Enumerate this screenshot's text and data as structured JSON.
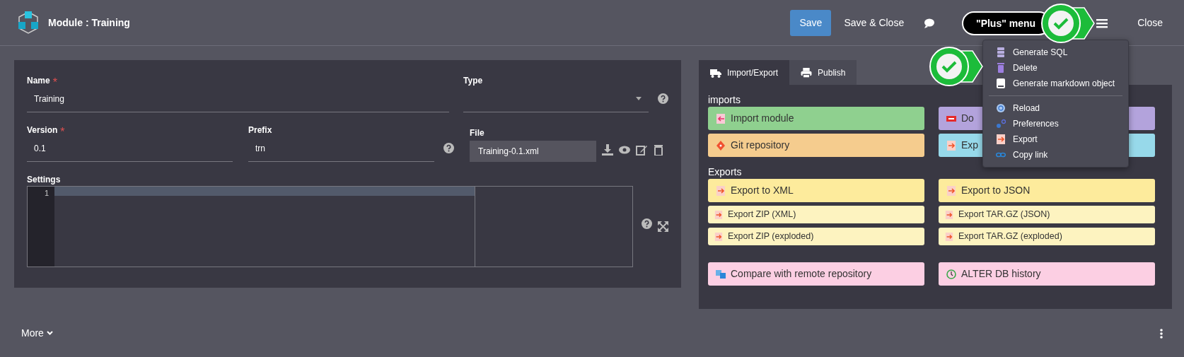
{
  "header": {
    "title": "Module : Training",
    "actions": [
      {
        "kind": "primary",
        "label": "Save"
      },
      {
        "kind": "link",
        "label": "Save & Close"
      },
      {
        "kind": "comment"
      },
      {
        "kind": "menu"
      },
      {
        "kind": "link",
        "label": "Close"
      }
    ]
  },
  "tooltip": {
    "text": "\"Plus\" menu"
  },
  "menu": {
    "groups": [
      [
        {
          "kind": "sql",
          "label": "Generate SQL"
        },
        {
          "kind": "delete",
          "label": "Delete"
        },
        {
          "kind": "markdown",
          "label": "Generate markdown object"
        }
      ],
      [
        {
          "kind": "reload",
          "label": "Reload"
        },
        {
          "kind": "preferences",
          "label": "Preferences"
        },
        {
          "kind": "export",
          "label": "Export"
        },
        {
          "kind": "link",
          "label": "Copy link"
        }
      ]
    ]
  },
  "form": {
    "name": {
      "label": "Name",
      "required_mark": "*",
      "value": "Training"
    },
    "type": {
      "label": "Type"
    },
    "version": {
      "label": "Version",
      "required_mark": "*",
      "value": "0.1"
    },
    "prefix": {
      "label": "Prefix",
      "value": "trn"
    },
    "file": {
      "label": "File",
      "value": "Training-0.1.xml"
    },
    "settings": {
      "label": "Settings",
      "line_numbers": [
        "1"
      ]
    }
  },
  "tabs": [
    {
      "kind": "truck",
      "label": "Import/Export",
      "selected": true
    },
    {
      "kind": "print",
      "label": "Publish",
      "selected": false
    }
  ],
  "sections": [
    {
      "title": "imports",
      "rows": [
        [
          {
            "kind": "import",
            "label": "Import module",
            "color": "#8fd08f",
            "compact": false
          },
          {
            "kind": "pdf",
            "label": "Do",
            "color": "#b3a3dc",
            "compact": false
          }
        ],
        [
          {
            "kind": "git",
            "label": "Git repository",
            "color": "#f5cc8e",
            "compact": false
          },
          {
            "kind": "export",
            "label": "Exp",
            "color": "#97d9ea",
            "compact": false
          }
        ]
      ]
    },
    {
      "title": "Exports",
      "rows": [
        [
          {
            "kind": "export",
            "label": "Export to XML",
            "color": "#fdeb9c",
            "compact": false
          },
          {
            "kind": "export",
            "label": "Export to JSON",
            "color": "#fdeb9c",
            "compact": false
          }
        ],
        [
          {
            "kind": "export",
            "label": "Export ZIP (XML)",
            "color": "#fdf3c0",
            "compact": true
          },
          {
            "kind": "export",
            "label": "Export TAR.GZ (JSON)",
            "color": "#fdf3c0",
            "compact": true
          }
        ],
        [
          {
            "kind": "export",
            "label": "Export ZIP (exploded)",
            "color": "#fdf3c0",
            "compact": true
          },
          {
            "kind": "export",
            "label": "Export TAR.GZ (exploded)",
            "color": "#fdf3c0",
            "compact": true
          }
        ]
      ]
    },
    {
      "rows": [
        [
          {
            "kind": "compare",
            "label": "Compare with remote repository",
            "color": "#fccfe3",
            "compact": false
          },
          {
            "kind": "history",
            "label": "ALTER DB history",
            "color": "#fccfe3",
            "compact": false
          }
        ]
      ]
    }
  ],
  "footer": {
    "more": "More"
  }
}
